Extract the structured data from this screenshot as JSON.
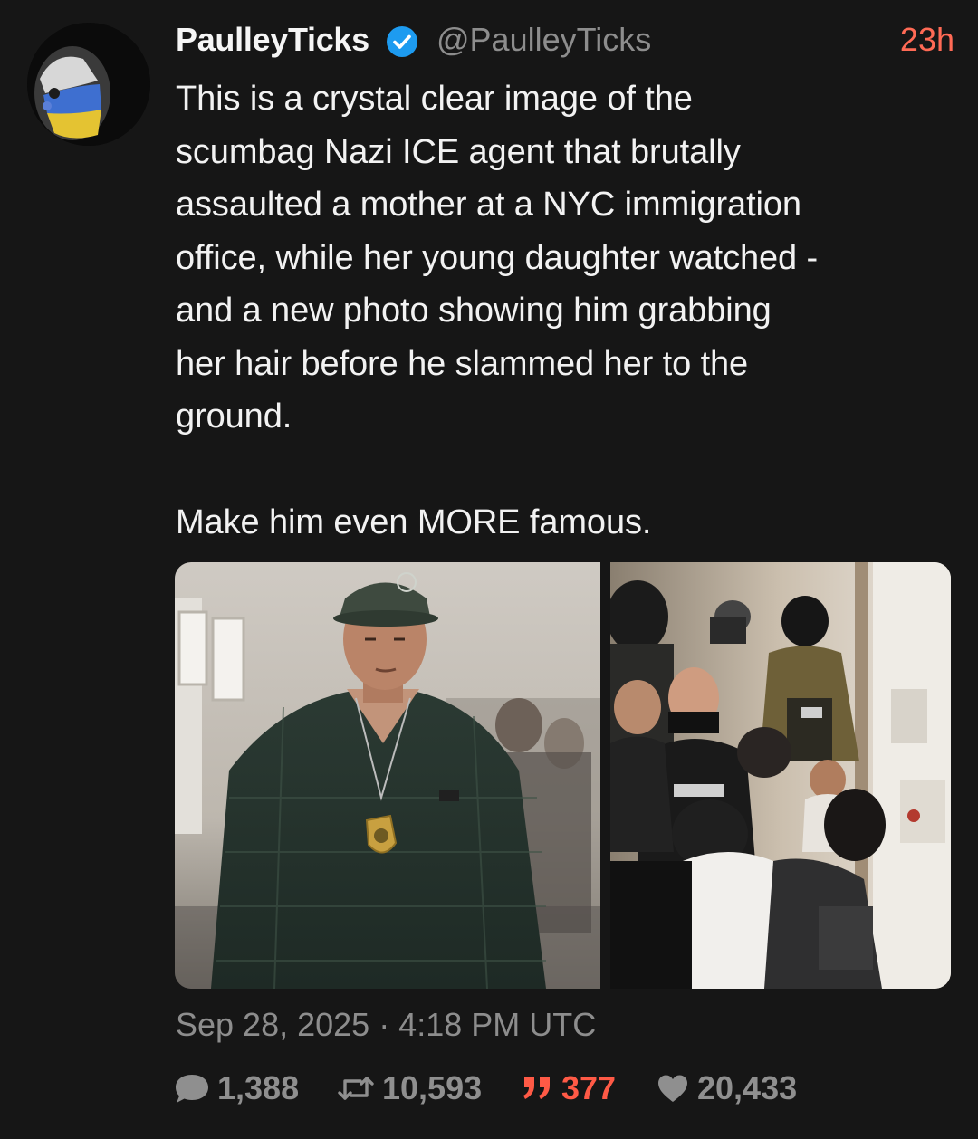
{
  "post": {
    "display_name": "PaulleyTicks",
    "handle": "@PaulleyTicks",
    "relative_time": "23h",
    "text": "This is a crystal clear image of the\nscumbag Nazi ICE agent that brutally\nassaulted a mother at a NYC immigration\noffice, while her young daughter watched -\nand a new photo showing him grabbing\nher hair before he slammed her to the\nground.\n\nMake him even MORE famous.",
    "datetime": "Sep 28, 2025 · 4:18 PM UTC",
    "verified": true
  },
  "stats": {
    "replies": "1,388",
    "reposts": "10,593",
    "quotes": "377",
    "likes": "20,433"
  },
  "icons": {
    "avatar": "avatar-image",
    "verified": "verified-badge-icon",
    "replies": "speech-bubble-icon",
    "reposts": "repost-arrows-icon",
    "quotes": "quote-marks-icon",
    "likes": "heart-icon"
  },
  "colors": {
    "background": "#161616",
    "accent": "#ff6a55",
    "quote_accent": "#ff5a46",
    "muted": "#8d8d8d",
    "verified_blue": "#1d9bf0"
  }
}
